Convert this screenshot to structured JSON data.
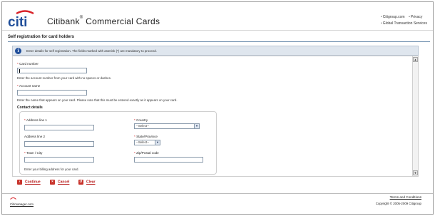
{
  "header": {
    "logo_text": "citi",
    "brand_name": "Citibank",
    "brand_registered": "®",
    "brand_suffix": "Commercial  Cards",
    "links": [
      {
        "label": "Citigroup.com"
      },
      {
        "label": "Privacy"
      },
      {
        "label": "Global Transaction Services"
      }
    ],
    "link_bullet": "•"
  },
  "page": {
    "title": "Self registration for card holders",
    "info_icon": "info-icon",
    "info_text": "Enter details for self registration. The fields marked with asterisk (*) are mandatory to proceed."
  },
  "form": {
    "required_mark": "*",
    "card_number": {
      "label": "Card number",
      "value": "",
      "hint": "Enter the account number from your card with no spaces or dashes."
    },
    "account_name": {
      "label": "Account name",
      "value": "",
      "hint": "Enter the name that appears on your card. Please note that this must be entered exactly as it appears on your card."
    },
    "contact": {
      "title": "Contact details",
      "address1": {
        "label": "Address line 1",
        "value": ""
      },
      "address2": {
        "label": "Address line 2",
        "value": ""
      },
      "town": {
        "label": "Town / City",
        "value": ""
      },
      "country": {
        "label": "Country",
        "selected": "--Select--"
      },
      "state": {
        "label": "State/Province",
        "selected": "--Select--"
      },
      "zip": {
        "label": "Zip/Postal code",
        "value": ""
      },
      "hint": "Enter your billing address for your card."
    }
  },
  "buttons": {
    "continue": "Continue",
    "cancel": "Cancel",
    "clear": "Clear"
  },
  "scrollbar": {
    "up": "▲",
    "down": "▼"
  },
  "footer": {
    "link": "Citimanager.com",
    "terms": "Terms and Conditions",
    "copyright": "Copyright © 2005-2009 Citigroup"
  },
  "colors": {
    "brand_red": "#d8232a",
    "brand_blue": "#1f4e9a",
    "button_red": "#c8342c"
  }
}
